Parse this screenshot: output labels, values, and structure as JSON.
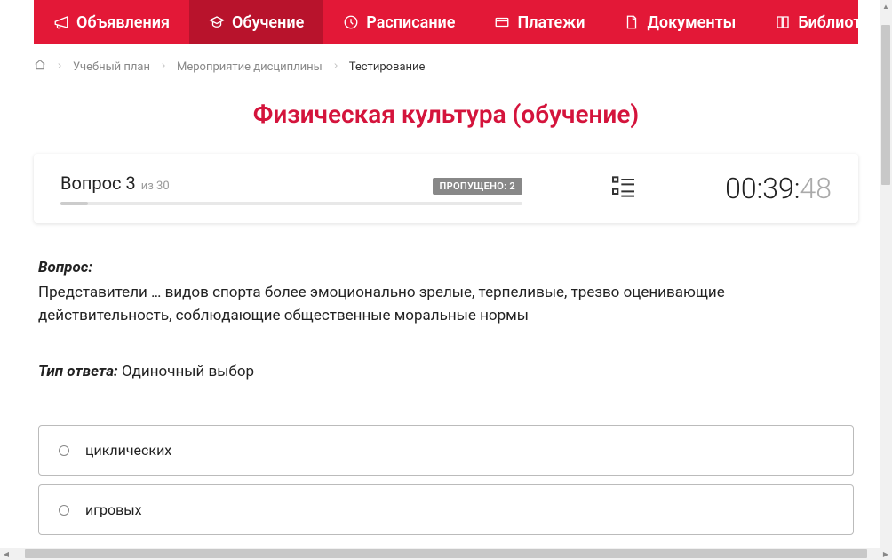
{
  "nav": {
    "items": [
      {
        "label": "Объявления",
        "icon": "megaphone"
      },
      {
        "label": "Обучение",
        "icon": "graduation",
        "active": true
      },
      {
        "label": "Расписание",
        "icon": "clock"
      },
      {
        "label": "Платежи",
        "icon": "card"
      },
      {
        "label": "Документы",
        "icon": "document"
      },
      {
        "label": "Библиотека",
        "icon": "book",
        "dropdown": true
      }
    ]
  },
  "breadcrumbs": {
    "items": [
      {
        "label": "Учебный план"
      },
      {
        "label": "Мероприятие дисциплины"
      }
    ],
    "current": "Тестирование"
  },
  "page_title": "Физическая культура (обучение)",
  "status": {
    "question_label": "Вопрос 3",
    "total_label": "из 30",
    "skipped_label": "ПРОПУЩЕНО: 2",
    "timer_main": "00:39:",
    "timer_seconds": "48",
    "progress_percent": 10
  },
  "question": {
    "label": "Вопрос:",
    "text": "Представители … видов спорта более эмоционально зрелые, терпеливые, трезво оценивающие действительность, соблюдающие общественные моральные нормы",
    "answer_type_label": "Тип ответа:",
    "answer_type_value": "Одиночный выбор",
    "options": [
      {
        "text": "циклических"
      },
      {
        "text": "игровых"
      }
    ]
  }
}
